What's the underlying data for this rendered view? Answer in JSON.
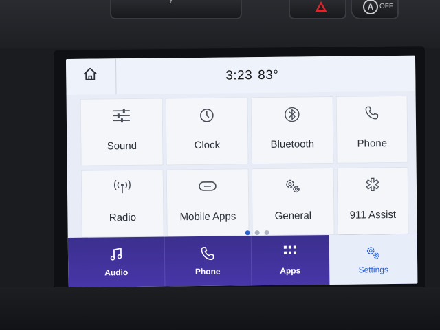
{
  "status_bar": {
    "time": "3:23",
    "temperature": "83°"
  },
  "page_indicator": {
    "count": 3,
    "active_index": 0
  },
  "tiles": [
    {
      "label": "Sound",
      "icon": "sliders-icon"
    },
    {
      "label": "Clock",
      "icon": "clock-icon"
    },
    {
      "label": "Bluetooth",
      "icon": "bluetooth-icon"
    },
    {
      "label": "Phone",
      "icon": "phone-icon"
    },
    {
      "label": "Radio",
      "icon": "radio-antenna-icon"
    },
    {
      "label": "Mobile Apps",
      "icon": "link-icon"
    },
    {
      "label": "General",
      "icon": "gears-icon"
    },
    {
      "label": "911 Assist",
      "icon": "emergency-icon"
    }
  ],
  "bottom_nav": [
    {
      "label": "Audio",
      "icon": "music-note-icon",
      "active": false
    },
    {
      "label": "Phone",
      "icon": "phone-icon",
      "active": false
    },
    {
      "label": "Apps",
      "icon": "apps-grid-icon",
      "active": false
    },
    {
      "label": "Settings",
      "icon": "gears-icon",
      "active": true
    }
  ],
  "hardware": {
    "auto_button_label": "OFF",
    "auto_button_letter": "A"
  },
  "colors": {
    "accent": "#2b62d6",
    "nav_background": "#3f3299",
    "screen_background": "#e7ecf6"
  }
}
